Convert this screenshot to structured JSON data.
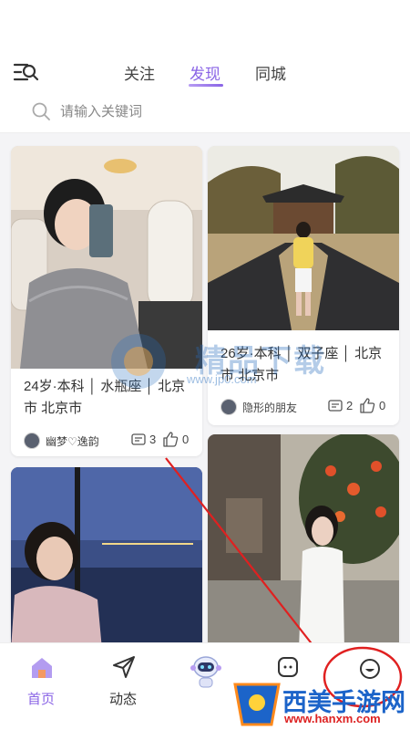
{
  "header": {
    "tabs": [
      {
        "label": "关注",
        "active": false
      },
      {
        "label": "发现",
        "active": true
      },
      {
        "label": "同城",
        "active": false
      }
    ]
  },
  "search": {
    "placeholder": "请输入关键词"
  },
  "feed": [
    {
      "desc_line1": "24岁·本科 │ 水瓶座 │ 北京",
      "desc_line2": "市 北京市",
      "user": "幽梦♡逸韵",
      "comments": "3",
      "likes": "0"
    },
    {
      "desc_line1": "26岁·本科 │ 双子座 │ 北京",
      "desc_line2": "市 北京市",
      "user": "隐形的朋友",
      "comments": "2",
      "likes": "0"
    }
  ],
  "bottom_nav": [
    {
      "label": "首页",
      "icon": "home-icon",
      "active": true
    },
    {
      "label": "动态",
      "icon": "send-icon",
      "active": false
    },
    {
      "label": "",
      "icon": "robot-icon",
      "active": false
    },
    {
      "label": "",
      "icon": "message-icon",
      "active": false
    },
    {
      "label": "",
      "icon": "profile-face-icon",
      "active": false
    }
  ],
  "watermark": {
    "text": "精品下载",
    "url": "www.jp0.com"
  },
  "site_logo": {
    "name": "西美手游网",
    "url": "www.hanxm.com"
  },
  "colors": {
    "accent": "#8a64e6",
    "annotation": "#e02020"
  }
}
